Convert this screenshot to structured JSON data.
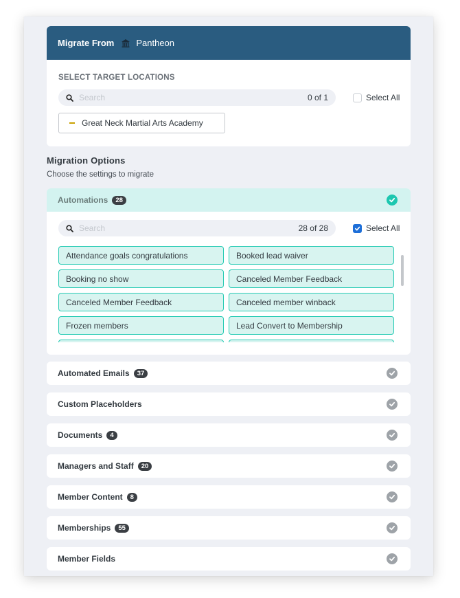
{
  "migrate_from": {
    "title": "Migrate From",
    "source_icon": "pantheon-logo-icon",
    "source": "Pantheon"
  },
  "target_locations": {
    "label": "SELECT TARGET LOCATIONS",
    "search_placeholder": "Search",
    "count": "0 of 1",
    "select_all_label": "Select All",
    "select_all_checked": false,
    "locations": [
      {
        "name": "Great Neck Martial Arts Academy",
        "marker_color": "#c9a000"
      }
    ]
  },
  "migration_options": {
    "title": "Migration Options",
    "subtitle": "Choose the settings to migrate",
    "automations": {
      "name": "Automations",
      "count": "28",
      "status": "complete",
      "search_placeholder": "Search",
      "selected_count": "28 of 28",
      "select_all_label": "Select All",
      "select_all_checked": true,
      "items": [
        "Attendance goals congratulations",
        "Booked lead waiver",
        "Booking no show",
        "Canceled Member Feedback",
        "Canceled Member Feedback",
        "Canceled member winback",
        "Frozen members",
        "Lead Convert to Membership"
      ]
    },
    "sections": [
      {
        "name": "Automated Emails",
        "count": "37"
      },
      {
        "name": "Custom Placeholders",
        "count": null
      },
      {
        "name": "Documents",
        "count": "4"
      },
      {
        "name": "Managers and Staff",
        "count": "20"
      },
      {
        "name": "Member Content",
        "count": "8"
      },
      {
        "name": "Memberships",
        "count": "55"
      },
      {
        "name": "Member Fields",
        "count": null
      }
    ]
  },
  "colors": {
    "header_bg": "#2a5c80",
    "accent_teal": "#1cc7b0",
    "chip_border": "#27cbb4",
    "chip_bg": "#d8f4f0",
    "badge_bg": "#3b3f44",
    "checkbox_blue": "#1e6fd8"
  }
}
